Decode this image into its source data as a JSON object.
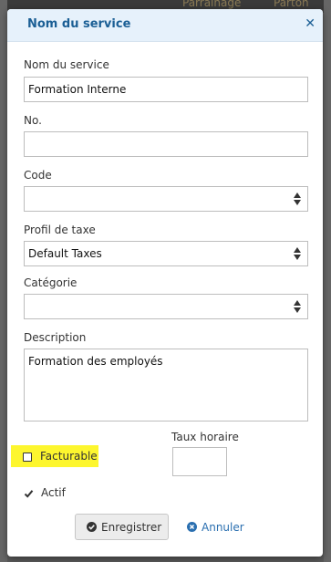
{
  "background": {
    "top_item_1": "Parrainage",
    "top_item_2": "Parton"
  },
  "modal": {
    "title": "Nom du service",
    "close_icon": "close-icon"
  },
  "form": {
    "service_name": {
      "label": "Nom du service",
      "value": "Formation Interne"
    },
    "number": {
      "label": "No.",
      "value": ""
    },
    "code": {
      "label": "Code",
      "value": ""
    },
    "tax_profile": {
      "label": "Profil de taxe",
      "value": "Default Taxes"
    },
    "category": {
      "label": "Catégorie",
      "value": ""
    },
    "description": {
      "label": "Description",
      "value": "Formation des employés"
    },
    "billable": {
      "label": "Facturable",
      "checked": false
    },
    "active": {
      "label": "Actif",
      "checked": true
    },
    "hourly_rate": {
      "label": "Taux horaire",
      "value": ""
    }
  },
  "buttons": {
    "save_label": "Enregistrer",
    "cancel_label": "Annuler"
  },
  "colors": {
    "header_bg": "#e6f1fb",
    "title": "#1b5f95",
    "highlight": "#fdf62e",
    "link": "#2a6fb0"
  }
}
